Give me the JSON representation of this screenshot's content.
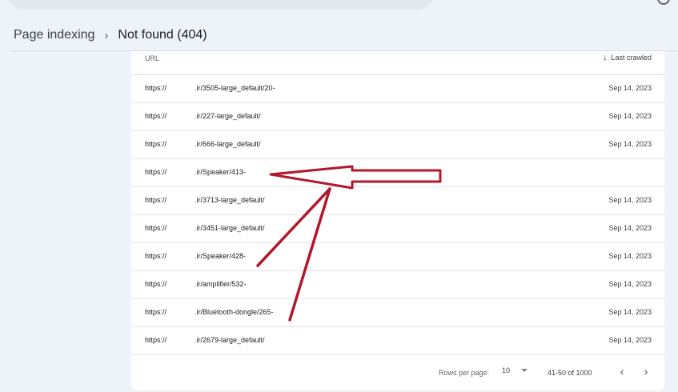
{
  "breadcrumb": {
    "parent": "Page indexing",
    "separator": "›",
    "current": "Not found (404)"
  },
  "table": {
    "col_url": "URL",
    "col_crawled": "Last crawled",
    "rows": [
      {
        "proto": "https://",
        "path": ".ir/3505-large_default/20-",
        "date": "Sep 14, 2023"
      },
      {
        "proto": "https://",
        "path": ".ir/227-large_default/",
        "date": "Sep 14, 2023"
      },
      {
        "proto": "https://",
        "path": ".ir/666-large_default/",
        "date": "Sep 14, 2023"
      },
      {
        "proto": "https://",
        "path": ".ir/Speaker/413-",
        "date": ""
      },
      {
        "proto": "https://",
        "path": ".ir/3713-large_default/",
        "date": "Sep 14, 2023"
      },
      {
        "proto": "https://",
        "path": ".ir/3451-large_default/",
        "date": "Sep 14, 2023"
      },
      {
        "proto": "https://",
        "path": ".ir/Speaker/428-",
        "date": "Sep 14, 2023"
      },
      {
        "proto": "https://",
        "path": ".ir/amplifier/532-",
        "date": "Sep 14, 2023"
      },
      {
        "proto": "https://",
        "path": ".ir/Bluetooth-dongle/265-",
        "date": "Sep 14, 2023"
      },
      {
        "proto": "https://",
        "path": ".ir/2679-large_default/",
        "date": "Sep 14, 2023"
      }
    ]
  },
  "pagination": {
    "rows_per_page_label": "Rows per page:",
    "rows_per_page_value": "10",
    "range": "41-50 of 1000",
    "prev_icon": "‹",
    "next_icon": "›"
  },
  "colors": {
    "background": "#eef2f9",
    "card": "#ffffff",
    "annotation_red": "#b2182b"
  }
}
